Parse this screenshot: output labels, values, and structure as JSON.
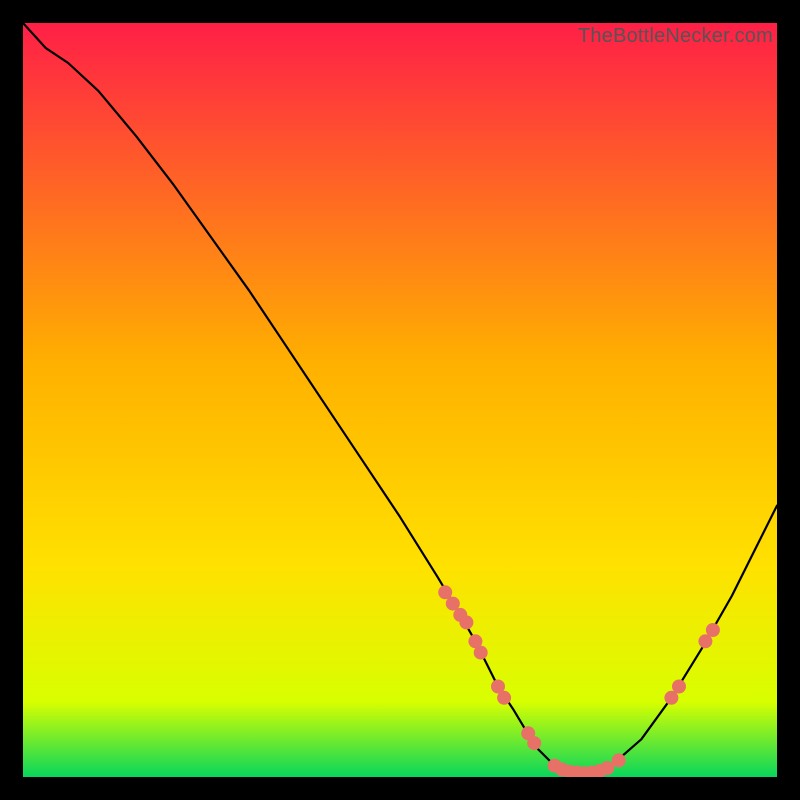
{
  "attribution": "TheBottleNecker.com",
  "chart_data": {
    "type": "line",
    "title": "",
    "xlabel": "",
    "ylabel": "",
    "xlim": [
      0,
      100
    ],
    "ylim": [
      0,
      100
    ],
    "background_gradient": {
      "top": "#ff1f47",
      "mid": "#ffe100",
      "bottom": "#08d65c"
    },
    "series": [
      {
        "name": "curve",
        "x": [
          0,
          3,
          6,
          10,
          15,
          20,
          25,
          30,
          35,
          40,
          45,
          50,
          55,
          58,
          60,
          63,
          65,
          68,
          70,
          73,
          75,
          78,
          82,
          86,
          90,
          94,
          97,
          100
        ],
        "y": [
          100,
          96.7,
          94.7,
          91,
          85,
          78.5,
          71.5,
          64.5,
          57,
          49.5,
          42,
          34.5,
          26.5,
          21.5,
          18,
          12,
          9,
          4,
          2,
          0.5,
          0.5,
          1.5,
          5,
          10.5,
          17,
          24,
          30,
          36
        ]
      }
    ],
    "markers": [
      {
        "x": 56.0,
        "y": 24.5
      },
      {
        "x": 57.0,
        "y": 23.0
      },
      {
        "x": 58.0,
        "y": 21.5
      },
      {
        "x": 58.8,
        "y": 20.5
      },
      {
        "x": 60.0,
        "y": 18.0
      },
      {
        "x": 60.7,
        "y": 16.5
      },
      {
        "x": 63.0,
        "y": 12.0
      },
      {
        "x": 63.8,
        "y": 10.5
      },
      {
        "x": 67.0,
        "y": 5.8
      },
      {
        "x": 67.8,
        "y": 4.5
      },
      {
        "x": 70.5,
        "y": 1.5
      },
      {
        "x": 71.5,
        "y": 1.0
      },
      {
        "x": 72.5,
        "y": 0.7
      },
      {
        "x": 73.5,
        "y": 0.6
      },
      {
        "x": 74.5,
        "y": 0.5
      },
      {
        "x": 75.5,
        "y": 0.6
      },
      {
        "x": 76.5,
        "y": 0.8
      },
      {
        "x": 77.5,
        "y": 1.2
      },
      {
        "x": 79.0,
        "y": 2.2
      },
      {
        "x": 86.0,
        "y": 10.5
      },
      {
        "x": 87.0,
        "y": 12.0
      },
      {
        "x": 90.5,
        "y": 18.0
      },
      {
        "x": 91.5,
        "y": 19.5
      }
    ],
    "marker_color": "#e77167",
    "marker_radius": 7
  }
}
